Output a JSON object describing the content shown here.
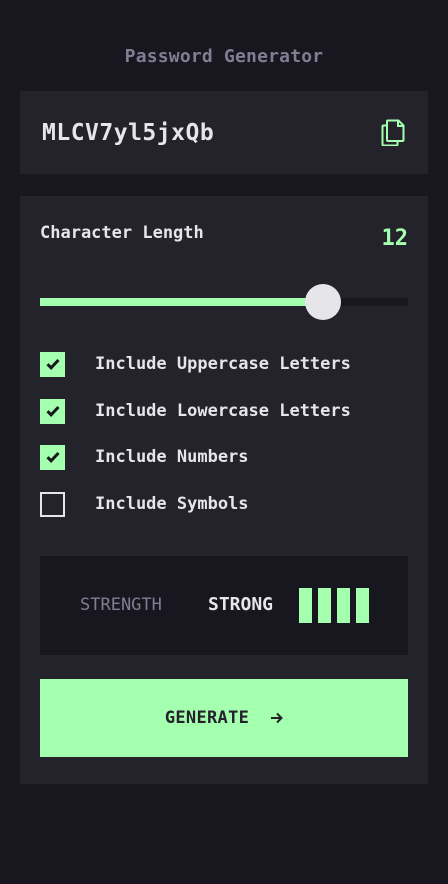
{
  "app": {
    "title": "Password Generator"
  },
  "output": {
    "password": "MLCV7yl5jxQb",
    "copy_icon": "copy-icon"
  },
  "length": {
    "label": "Character Length",
    "value": "12",
    "min": 0,
    "max": 20,
    "current": 12
  },
  "options": [
    {
      "label": "Include Uppercase Letters",
      "checked": true
    },
    {
      "label": "Include Lowercase Letters",
      "checked": true
    },
    {
      "label": "Include Numbers",
      "checked": true
    },
    {
      "label": "Include Symbols",
      "checked": false
    }
  ],
  "strength": {
    "label": "STRENGTH",
    "value": "STRONG",
    "level": 4,
    "max_level": 4
  },
  "generate": {
    "label": "GENERATE",
    "icon": "arrow-right-icon"
  },
  "colors": {
    "accent": "#a4ffaf",
    "background": "#18171f",
    "panel": "#24232c",
    "muted": "#817d92",
    "text": "#e6e5ea"
  }
}
